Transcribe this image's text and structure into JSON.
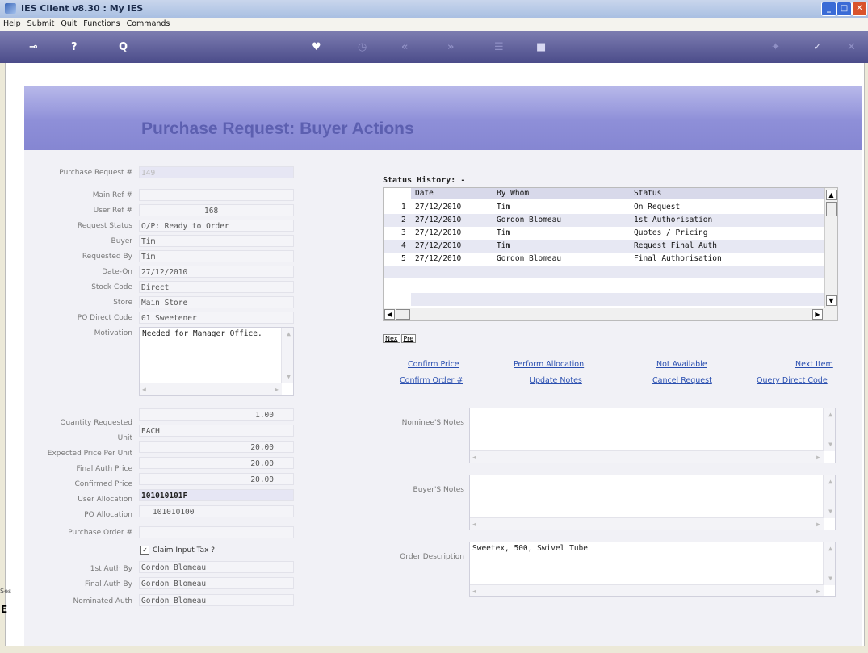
{
  "window": {
    "title": "IES Client v8.30 : My IES"
  },
  "menu": [
    "Help",
    "Submit",
    "Quit",
    "Functions",
    "Commands"
  ],
  "toolbar": {
    "icons": [
      "key-icon",
      "help-icon",
      "search-icon",
      "heart-icon",
      "clock-icon",
      "rewind-icon",
      "forward-icon",
      "list-icon",
      "square-icon",
      "settings-icon",
      "check-icon",
      "close-icon"
    ],
    "glyphs": {
      "key": "⊸",
      "help": "?",
      "search": "Q",
      "heart": "♥",
      "clock": "◷",
      "rewind": "«",
      "forward": "»",
      "list": "☰",
      "square": "■",
      "settings": "✦",
      "check": "✓",
      "close": "✕"
    }
  },
  "page_title": "Purchase Request: Buyer Actions",
  "form": {
    "purchase_request_no": {
      "label": "Purchase Request #",
      "value": "149"
    },
    "main_ref": {
      "label": "Main Ref #",
      "value": ""
    },
    "user_ref": {
      "label": "User Ref #",
      "value": "168"
    },
    "request_status": {
      "label": "Request Status",
      "value": "O/P: Ready to Order"
    },
    "buyer": {
      "label": "Buyer",
      "value": "Tim"
    },
    "requested_by": {
      "label": "Requested By",
      "value": "Tim"
    },
    "date_on": {
      "label": "Date-On",
      "value": "27/12/2010"
    },
    "stock_code": {
      "label": "Stock Code",
      "value": "Direct"
    },
    "store": {
      "label": "Store",
      "value": "Main Store"
    },
    "po_direct_code": {
      "label": "PO Direct Code",
      "value": "01 Sweetener"
    },
    "motivation": {
      "label": "Motivation",
      "value": "Needed for Manager Office."
    },
    "quantity_requested": {
      "label": "Quantity Requested",
      "value": "1.00"
    },
    "unit": {
      "label": "Unit",
      "value": "EACH"
    },
    "expected_price": {
      "label": "Expected Price Per Unit",
      "value": "20.00"
    },
    "final_auth_price": {
      "label": "Final Auth Price",
      "value": "20.00"
    },
    "confirmed_price": {
      "label": "Confirmed Price",
      "value": "20.00"
    },
    "user_allocation": {
      "label": "User Allocation",
      "value": "101010101F"
    },
    "po_allocation": {
      "label": "PO Allocation",
      "value": "101010100"
    },
    "purchase_order": {
      "label": "Purchase Order #",
      "value": ""
    },
    "claim_input_tax": {
      "label": "Claim Input Tax ?",
      "checked": true
    },
    "first_auth_by": {
      "label": "1st Auth By",
      "value": "Gordon Blomeau"
    },
    "final_auth_by": {
      "label": "Final Auth By",
      "value": "Gordon Blomeau"
    },
    "nominated_auth": {
      "label": "Nominated Auth",
      "value": "Gordon Blomeau"
    }
  },
  "status_history": {
    "title": "Status History: -",
    "columns": [
      "Date",
      "By Whom",
      "Status"
    ],
    "rows": [
      {
        "n": "1",
        "date": "27/12/2010",
        "by": "Tim",
        "status": "On Request"
      },
      {
        "n": "2",
        "date": "27/12/2010",
        "by": "Gordon Blomeau",
        "status": "1st Authorisation"
      },
      {
        "n": "3",
        "date": "27/12/2010",
        "by": "Tim",
        "status": "Quotes / Pricing"
      },
      {
        "n": "4",
        "date": "27/12/2010",
        "by": "Tim",
        "status": "Request Final Auth"
      },
      {
        "n": "5",
        "date": "27/12/2010",
        "by": "Gordon Blomeau",
        "status": "Final Authorisation"
      }
    ],
    "nav": {
      "next": "Nex",
      "prev": "Pre"
    }
  },
  "actions": {
    "confirm_price": "Confirm Price",
    "perform_allocation": "Perform Allocation",
    "not_available": "Not Available",
    "next_item": "Next Item",
    "confirm_order": "Confirm Order #",
    "update_notes": "Update Notes",
    "cancel_request": "Cancel Request",
    "query_direct_code": "Query Direct Code"
  },
  "notes": {
    "nominee": {
      "label": "Nominee'S Notes",
      "value": ""
    },
    "buyer": {
      "label": "Buyer'S Notes",
      "value": ""
    },
    "order_description": {
      "label": "Order Description",
      "value": "Sweetex, 500, Swivel Tube"
    }
  },
  "side_fragments": {
    "top": "Ses",
    "bottom": "E"
  }
}
